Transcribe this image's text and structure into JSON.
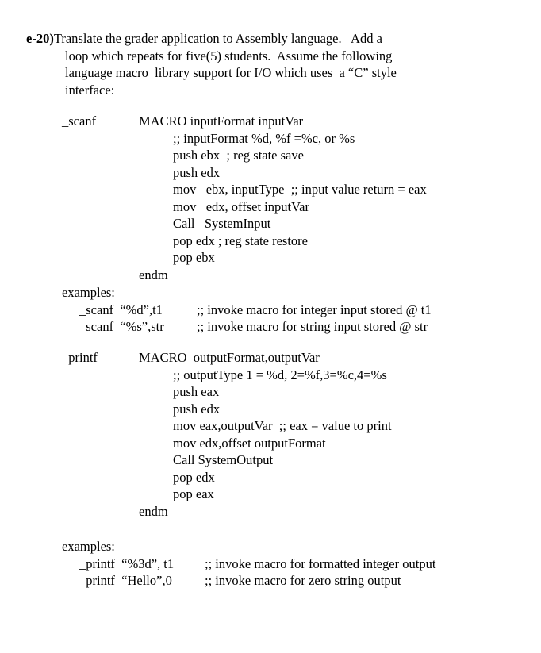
{
  "document": {
    "question": {
      "label": "e-20)",
      "lines": [
        "Translate the grader application to Assembly language.   Add a",
        "loop which repeats for five(5) students.  Assume the following",
        "language macro  library support for I/O which uses  a “C” style",
        "interface:"
      ]
    },
    "scanf_macro": {
      "name": "_scanf",
      "header": "MACRO inputFormat inputVar",
      "body": [
        ";; inputFormat %d, %f =%c, or %s",
        "push ebx  ; reg state save",
        "push edx",
        "mov   ebx, inputType  ;; input value return = eax",
        "mov   edx, offset inputVar",
        "Call   SystemInput",
        "pop edx ; reg state restore",
        "pop ebx"
      ],
      "end": "endm"
    },
    "scanf_examples": {
      "heading": "examples:",
      "rows": [
        {
          "code": "_scanf  “%d”,t1",
          "comment": ";; invoke macro for integer input stored @ t1"
        },
        {
          "code": "_scanf  “%s”,str",
          "comment": ";; invoke macro for string input stored @ str"
        }
      ]
    },
    "printf_macro": {
      "name": "_printf",
      "header": "MACRO  outputFormat,outputVar",
      "body": [
        ";; outputType 1 = %d, 2=%f,3=%c,4=%s",
        "push eax",
        "push edx",
        "mov eax,outputVar  ;; eax = value to print",
        "mov edx,offset outputFormat",
        "Call SystemOutput",
        "pop edx",
        "pop eax"
      ],
      "end": "endm"
    },
    "printf_examples": {
      "heading": "examples:",
      "rows": [
        {
          "code": "_printf  “%3d”, t1",
          "comment": ";; invoke macro for formatted integer output"
        },
        {
          "code": "_printf  “Hello”,0",
          "comment": ";; invoke macro for zero string output"
        }
      ]
    }
  }
}
